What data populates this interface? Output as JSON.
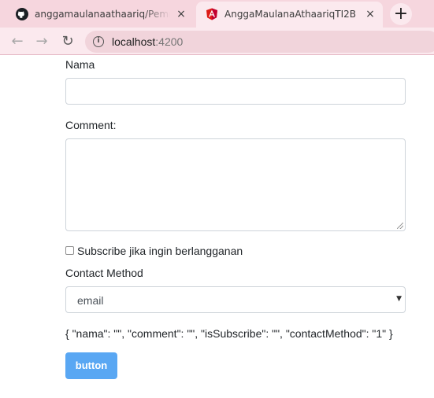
{
  "browser": {
    "tabs": [
      {
        "title": "anggamaulanaathaariq/Pemrogra",
        "icon": "github-icon",
        "close": "×"
      },
      {
        "title": "AnggaMaulanaAthaariqTI2B",
        "icon": "angular-icon",
        "close": "×"
      }
    ],
    "new_tab": "+",
    "nav": {
      "back": "←",
      "forward": "→",
      "reload": "↻"
    },
    "info_icon": "i",
    "url_host": "localhost",
    "url_port": ":4200",
    "accent": "#f6d6de"
  },
  "form": {
    "nama_label": "Nama",
    "nama_value": "",
    "comment_label": "Comment:",
    "comment_value": "",
    "subscribe_label": "Subscribe jika ingin berlangganan",
    "subscribe_checked": false,
    "contact_label": "Contact Method",
    "contact_selected": "email",
    "select_arrow": "▼",
    "json_output": "{ \"nama\": \"\", \"comment\": \"\", \"isSubscribe\": \"\", \"contactMethod\": \"1\" }",
    "button_label": "button",
    "button_color": "#59a7f3"
  }
}
